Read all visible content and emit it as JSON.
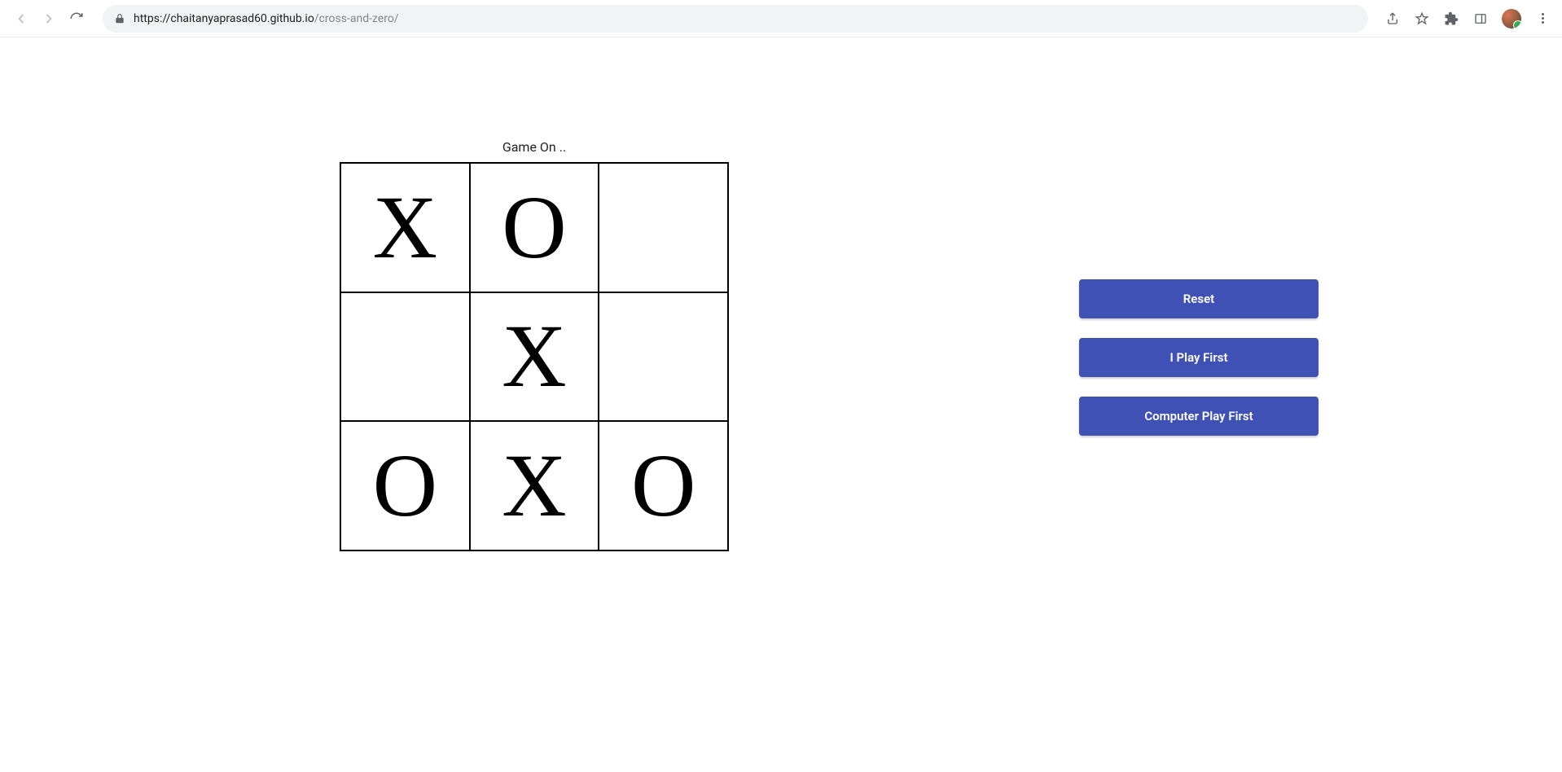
{
  "browser": {
    "url_host": "https://chaitanyaprasad60.github.io",
    "url_path": "/cross-and-zero/"
  },
  "game": {
    "status": "Game On ..",
    "board": [
      [
        "X",
        "O",
        ""
      ],
      [
        "",
        "X",
        ""
      ],
      [
        "O",
        "X",
        "O"
      ]
    ]
  },
  "buttons": {
    "reset": "Reset",
    "i_play_first": "I Play First",
    "computer_play_first": "Computer Play First"
  }
}
